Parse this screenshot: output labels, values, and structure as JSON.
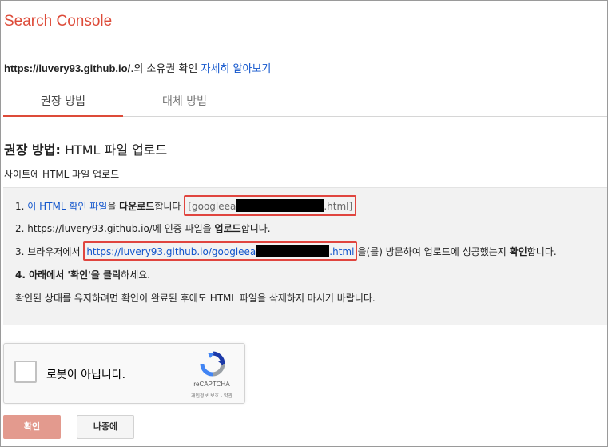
{
  "header": {
    "app_title": "Search Console"
  },
  "ownership": {
    "site": "https://luvery93.github.io/",
    "suffix": ".의 소유권 확인 ",
    "learn_more": "자세히 알아보기"
  },
  "tabs": [
    {
      "label": "권장 방법",
      "active": true
    },
    {
      "label": "대체 방법",
      "active": false
    }
  ],
  "method": {
    "title_bold": "권장 방법:",
    "title_rest": " HTML 파일 업로드",
    "subtitle": "사이트에 HTML 파일 업로드"
  },
  "steps": {
    "s1_num": "1. ",
    "s1_link": "이 HTML 확인 파일",
    "s1_mid": "을 ",
    "s1_bold": "다운로드",
    "s1_end": "합니다",
    "s1_file_prefix": "[googleea",
    "s1_file_suffix": ".html]",
    "s2_text": "2. https://luvery93.github.io/에 인증 파일을 ",
    "s2_bold": "업로드",
    "s2_end": "합니다.",
    "s3_start": "3. 브라우저에서 ",
    "s3_link_prefix": "https://luvery93.github.io/googleea",
    "s3_link_suffix": ".html",
    "s3_mid": "을(를) 방문하여 업로드에 성공했는지 ",
    "s3_bold": "확인",
    "s3_end": "합니다.",
    "s4_bold": "4. 아래에서 '확인'을 클릭",
    "s4_end": "하세요.",
    "note": "확인된 상태를 유지하려면 확인이 완료된 후에도 HTML 파일을 삭제하지 마시기 바랍니다."
  },
  "recaptcha": {
    "label": "로봇이 아닙니다.",
    "brand": "reCAPTCHA",
    "terms": "개인정보 보호 - 약관"
  },
  "buttons": {
    "confirm": "확인",
    "later": "나중에"
  },
  "colors": {
    "brand_red": "#dd4b39",
    "link_blue": "#1155cc",
    "highlight_box": "#e0453f",
    "confirm_button": "#e39a8e"
  }
}
